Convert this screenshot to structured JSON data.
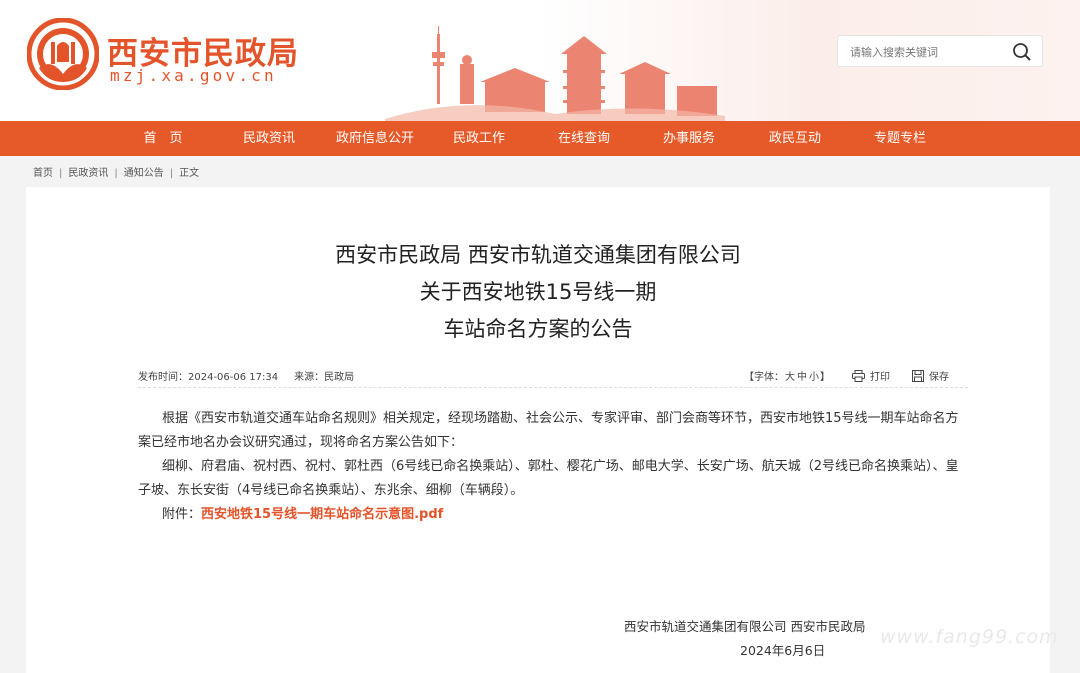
{
  "site": {
    "name": "西安市民政局",
    "domain": "mzj.xa.gov.cn"
  },
  "search": {
    "placeholder": "请输入搜索关键词"
  },
  "nav": [
    "首　页",
    "民政资讯",
    "政府信息公开",
    "民政工作",
    "在线查询",
    "办事服务",
    "政民互动",
    "专题专栏"
  ],
  "breadcrumb": [
    "首页",
    "民政资讯",
    "通知公告",
    "正文"
  ],
  "article": {
    "title_lines": [
      "西安市民政局 西安市轨道交通集团有限公司",
      "关于西安地铁15号线一期",
      "车站命名方案的公告"
    ],
    "publish_label": "发布时间：",
    "publish_time": "2024-06-06 17:34",
    "source_label": "来源：",
    "source": "民政局",
    "font_label": "【字体：",
    "font_large": "大",
    "font_medium": "中",
    "font_small": "小",
    "font_close": "】",
    "print_label": "打印",
    "save_label": "保存",
    "para1": "根据《西安市轨道交通车站命名规则》相关规定，经现场踏勘、社会公示、专家评审、部门会商等环节，西安市地铁15号线一期车站命名方案已经市地名办会议研究通过，现将命名方案公告如下：",
    "para2": "细柳、府君庙、祝村西、祝村、郭杜西（6号线已命名换乘站）、郭杜、樱花广场、邮电大学、长安广场、航天城（2号线已命名换乘站）、皇子坡、东长安街（4号线已命名换乘站）、东兆余、细柳（车辆段）。",
    "attach_label": "附件：",
    "attach_file": "西安地铁15号线一期车站命名示意图.pdf",
    "signer": "西安市轨道交通集团有限公司 西安市民政局",
    "date": "2024年6月6日"
  },
  "watermark": "www.fang99.com",
  "colors": {
    "brand": "#e65a2a",
    "link": "#e3542a"
  }
}
